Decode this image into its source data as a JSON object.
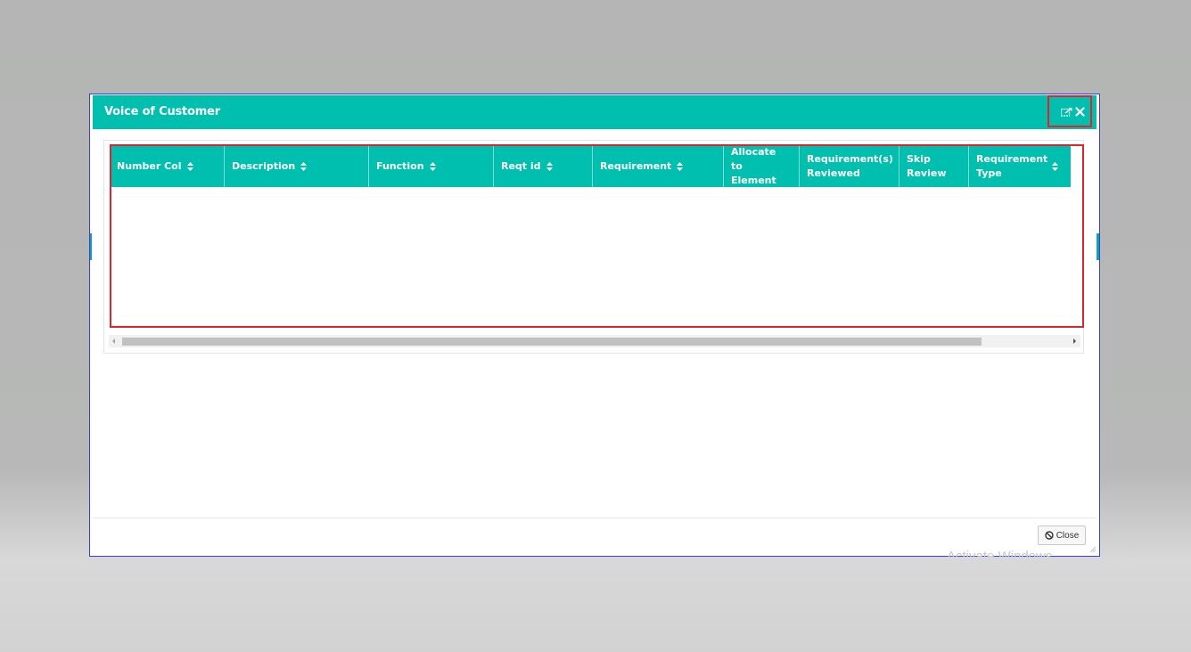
{
  "modal": {
    "title": "Voice of Customer",
    "header_color": "#00bfae",
    "highlight_color": "#e0242e",
    "icons": {
      "restore": "restore-window-icon",
      "close": "close-icon"
    }
  },
  "table": {
    "columns": [
      {
        "label": "Number Col",
        "sortable": true
      },
      {
        "label": "Description",
        "sortable": true
      },
      {
        "label": "Function",
        "sortable": true
      },
      {
        "label": "Reqt id",
        "sortable": true
      },
      {
        "label": "Requirement",
        "sortable": true
      },
      {
        "label": "Allocate to Element",
        "sortable": false
      },
      {
        "label": "Requirement(s) Reviewed",
        "sortable": false
      },
      {
        "label": "Skip Review",
        "sortable": false
      },
      {
        "label": "Requirement Type",
        "sortable": true
      }
    ],
    "rows": []
  },
  "footer": {
    "close_label": "Close"
  },
  "watermark": "Activate Windows"
}
